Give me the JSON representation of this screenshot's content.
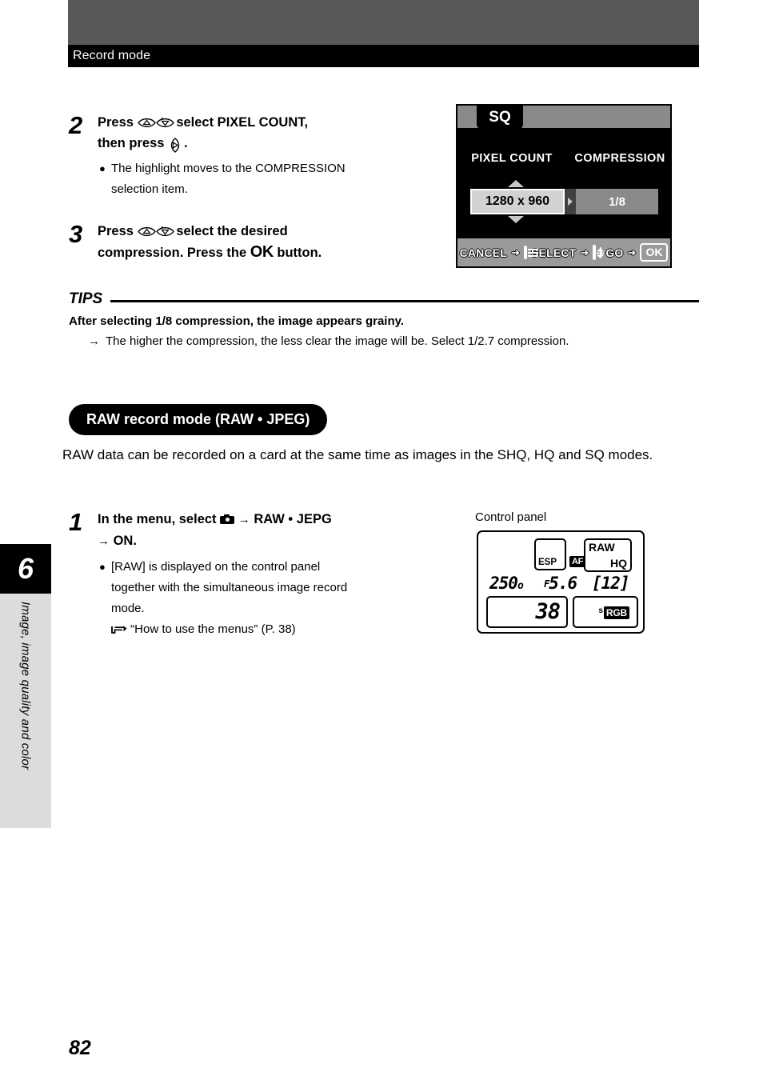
{
  "header": {
    "title": "Record mode"
  },
  "side_tab": {
    "chapter_number": "6",
    "chapter_label": "Image, image quality and color"
  },
  "steps_top": [
    {
      "number": "2",
      "head_part1": "Press",
      "head_icon1": "updown-pad-icon",
      "head_part2": "to select PIXEL COUNT,",
      "head_part3": "then press",
      "head_icon2": "right-pad-icon",
      "head_part4": ".",
      "bullets": [
        "The highlight moves to the COMPRESSION",
        "selection item."
      ]
    },
    {
      "number": "3",
      "head_part1": "Press",
      "head_icon1": "updown-pad-icon",
      "head_part2": "to select the desired",
      "head_part3": "compression. Press the",
      "head_ok": "OK",
      "head_part4": "button."
    }
  ],
  "lcd_menu": {
    "tab_label": "SQ",
    "column_pixel": "PIXEL COUNT",
    "column_compression": "COMPRESSION",
    "pixel_value": "1280 x 960",
    "compression_value": "1/8",
    "bottom_bar": {
      "cancel_label": "CANCEL",
      "cancel_arrow": "➜",
      "menu_icon": "menu-list-icon",
      "select_label": "SELECT",
      "select_arrow": "➜",
      "updown_icon": "updown-pad-icon",
      "right_stub_icon": "right-arrow-stub-icon",
      "go_label": "GO",
      "go_arrow": "➜",
      "ok_label": "OK"
    }
  },
  "tips": {
    "label": "TIPS",
    "bold_line": "After selecting 1/8 compression, the image appears grainy.",
    "note_arrow": "→",
    "note_text": "The higher the compression, the less clear the image will be. Select 1/2.7 compression."
  },
  "raw_section": {
    "pill_title": "RAW record mode (RAW • JPEG)",
    "description": "RAW data can be recorded on a card at the same time as images in the SHQ, HQ and SQ modes.",
    "step": {
      "number": "1",
      "head_part1": "In the menu, select",
      "head_icon": "camera-icon",
      "head_arrow1": "→",
      "head_part2": "RAW • JEPG",
      "head_arrow2": "→",
      "head_part3": "ON.",
      "bullets": [
        "[RAW] is displayed on the control panel",
        "together with the simultaneous image record",
        "mode."
      ],
      "reference_icon": "pointing-hand-icon",
      "reference_text": "“How to use the menus” (P. 38)"
    }
  },
  "control_panel": {
    "label": "Control panel",
    "esp": "ESP",
    "af": "AF",
    "raw": "RAW",
    "hq": "HQ",
    "shutter_speed": "250",
    "shutter_suffix": "o",
    "aperture_prefix": "F",
    "aperture": "5.6",
    "frames_remaining": "[12]",
    "exposure_value": "38",
    "colorspace_prefix": "s",
    "colorspace": "RGB"
  },
  "page_number": "82"
}
